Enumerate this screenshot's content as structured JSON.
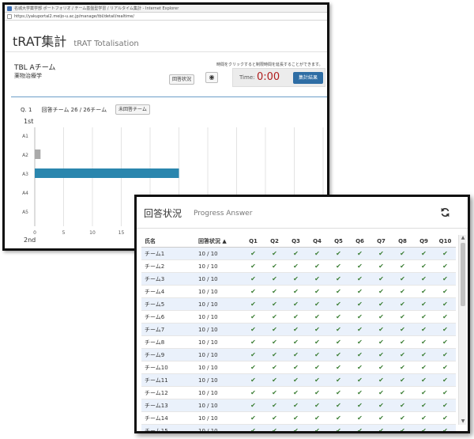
{
  "browser": {
    "title": "名城大学薬学部 ポートフォリオ / チーム基盤型学習 / リアルタイム集計 - Internet Explorer",
    "url": "https://yakuportal2.meijo-u.ac.jp/manage/tbl/detail/realtime/"
  },
  "page": {
    "title": "tRAT集計",
    "subtitle": "tRAT Totalisation"
  },
  "team": {
    "name": "TBL Aチーム",
    "subject": "薬物治療学"
  },
  "controls": {
    "status_button": "回答状況",
    "eye_icon": "eye-icon",
    "hint": "時間をクリックすると制限時間を延長することができます。",
    "time_label": "Time:",
    "time_value": "0:00",
    "finish_button": "集計結果"
  },
  "question": {
    "number": "Q. 1",
    "answered": "回答チーム 26 / 26チーム",
    "unanswered_button": "未回答チーム",
    "first_label": "1st",
    "second_label": "2nd"
  },
  "chart_data": {
    "type": "bar",
    "orientation": "horizontal",
    "categories": [
      "A1",
      "A2",
      "A3",
      "A4",
      "A5"
    ],
    "values": [
      0,
      1,
      25,
      0,
      0
    ],
    "colors": [
      "#cccccc",
      "#aaaaaa",
      "#2a86ae",
      "#cccccc",
      "#cccccc"
    ],
    "xticks": [
      0,
      5,
      10,
      15
    ],
    "xlim": [
      0,
      50
    ],
    "grid": true
  },
  "progress": {
    "title": "回答状況",
    "subtitle": "Progress Answer",
    "refresh_icon": "refresh-icon",
    "columns": [
      "氏名",
      "回答状況 ▲",
      "Q1",
      "Q2",
      "Q3",
      "Q4",
      "Q5",
      "Q6",
      "Q7",
      "Q8",
      "Q9",
      "Q10"
    ],
    "check_glyph": "✔",
    "rows": [
      {
        "name": "チーム1",
        "status": "10 / 10"
      },
      {
        "name": "チーム2",
        "status": "10 / 10"
      },
      {
        "name": "チーム3",
        "status": "10 / 10"
      },
      {
        "name": "チーム4",
        "status": "10 / 10"
      },
      {
        "name": "チーム5",
        "status": "10 / 10"
      },
      {
        "name": "チーム6",
        "status": "10 / 10"
      },
      {
        "name": "チーム7",
        "status": "10 / 10"
      },
      {
        "name": "チーム8",
        "status": "10 / 10"
      },
      {
        "name": "チーム9",
        "status": "10 / 10"
      },
      {
        "name": "チーム10",
        "status": "10 / 10"
      },
      {
        "name": "チーム11",
        "status": "10 / 10"
      },
      {
        "name": "チーム12",
        "status": "10 / 10"
      },
      {
        "name": "チーム13",
        "status": "10 / 10"
      },
      {
        "name": "チーム14",
        "status": "10 / 10"
      },
      {
        "name": "チーム15",
        "status": "10 / 10"
      }
    ]
  }
}
